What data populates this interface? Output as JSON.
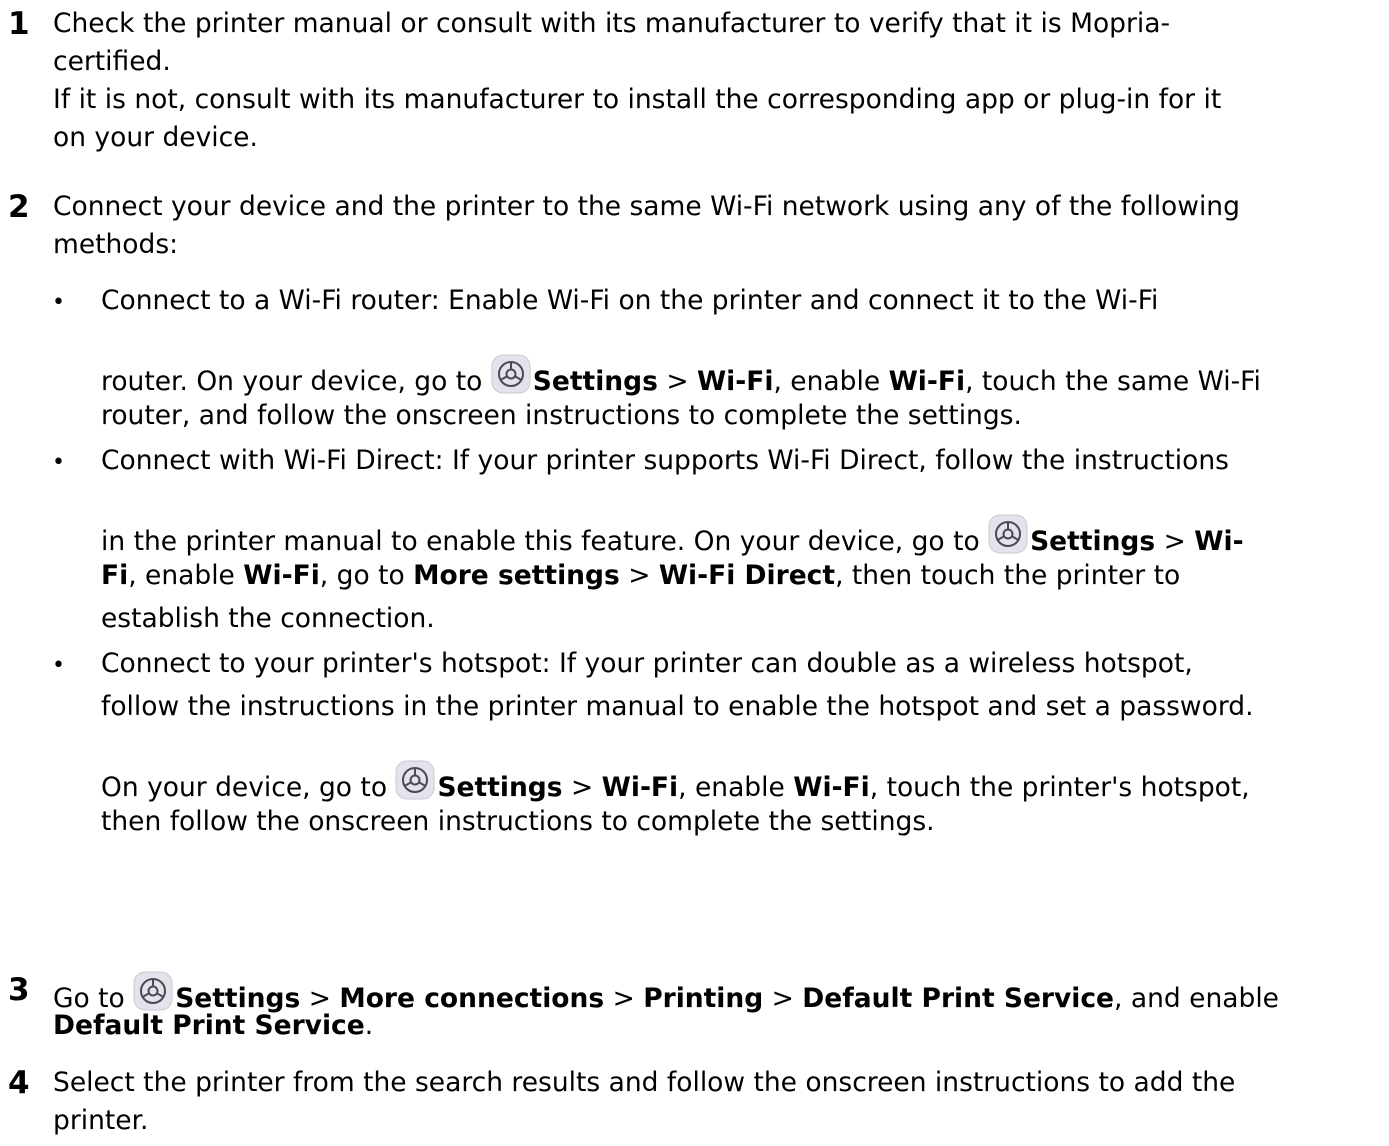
{
  "step1": {
    "number": "1",
    "line1": "Check the printer manual or consult with its manufacturer to verify that it is Mopria-",
    "line2": "certified.",
    "line3": "If it is not, consult with its manufacturer to install the corresponding app or plug-in for it",
    "line4": "on your device."
  },
  "step2": {
    "number": "2",
    "line1": "Connect your device and the printer to the same Wi-Fi network using any of the following",
    "line2": "methods:",
    "bullet_char": "•",
    "b1": {
      "l1": "Connect to a Wi-Fi router: Enable Wi-Fi on the printer and connect it to the Wi-Fi",
      "l2_pre": "router. On your device, go to ",
      "settings": "Settings",
      "sep1": " > ",
      "wifi": "Wi-Fi",
      "t2": ", enable ",
      "wifi2": "Wi-Fi",
      "t3": ", touch the same Wi-Fi",
      "l3": "router, and follow the onscreen instructions to complete the settings."
    },
    "b2": {
      "l1": "Connect with Wi-Fi Direct: If your printer supports Wi-Fi Direct, follow the instructions",
      "l2_pre": "in the printer manual to enable this feature. On your device, go to ",
      "settings": "Settings",
      "sep1": " > ",
      "wi": "Wi-",
      "fi": "Fi",
      "t2": ", enable ",
      "wifi2": "Wi-Fi",
      "t3": ", go to ",
      "more": "More settings",
      "sep2": " > ",
      "direct": "Wi-Fi Direct",
      "t4": ", then touch the printer to",
      "l4": "establish the connection."
    },
    "b3": {
      "l1": "Connect to your printer's hotspot: If your printer can double as a wireless hotspot,",
      "l2": "follow the instructions in the printer manual to enable the hotspot and set a password.",
      "l3_pre": "On your device, go to ",
      "settings": "Settings",
      "sep1": " > ",
      "wifi": "Wi-Fi",
      "t2": ", enable ",
      "wifi2": "Wi-Fi",
      "t3": ", touch the printer's hotspot,",
      "l4": "then follow the onscreen instructions to complete the settings."
    }
  },
  "step3": {
    "number": "3",
    "pre": "Go to ",
    "settings": "Settings",
    "sep1": " > ",
    "more": "More connections",
    "sep2": " > ",
    "printing": "Printing",
    "sep3": " > ",
    "dps": "Default Print Service",
    "t2": ", and enable",
    "dps2": "Default Print Service",
    "end": "."
  },
  "step4": {
    "number": "4",
    "line1": "Select the printer from the search results and follow the onscreen instructions to add the",
    "line2": "printer."
  },
  "icons": {
    "settings_icon": "gear-icon",
    "icon_bg": "#e3e3eb",
    "icon_stroke": "#4a4a55"
  }
}
